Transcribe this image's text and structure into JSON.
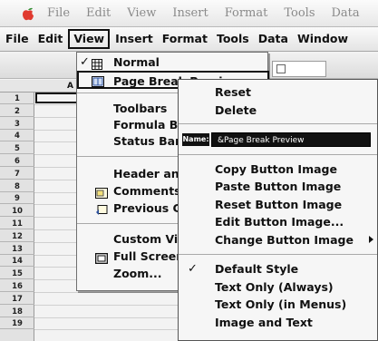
{
  "app_menubar": {
    "items": [
      "File",
      "Edit",
      "View",
      "Insert",
      "Format",
      "Tools",
      "Data"
    ]
  },
  "customize_menubar": {
    "items": [
      "File",
      "Edit",
      "View",
      "Insert",
      "Format",
      "Tools",
      "Data",
      "Window"
    ],
    "active": "View"
  },
  "sheet": {
    "column_header": "A",
    "rows": [
      "1",
      "2",
      "3",
      "4",
      "5",
      "6",
      "7",
      "8",
      "9",
      "10",
      "11",
      "12",
      "13",
      "14",
      "15",
      "16",
      "17",
      "18",
      "19"
    ]
  },
  "view_menu": {
    "items": [
      {
        "label": "Normal",
        "icon": "normal-view-icon",
        "checked": true
      },
      {
        "label": "Page Break Preview",
        "icon": "page-break-icon",
        "highlighted": true
      },
      {
        "label": "Toolbars"
      },
      {
        "label": "Formula Bar"
      },
      {
        "label": "Status Bar"
      },
      {
        "label": "Header and Footer"
      },
      {
        "label": "Comments",
        "icon": "comments-icon"
      },
      {
        "label": "Previous Comments",
        "icon": "previous-comments-icon"
      },
      {
        "label": "Custom Views"
      },
      {
        "label": "Full Screen",
        "icon": "full-screen-icon"
      },
      {
        "label": "Zoom..."
      }
    ]
  },
  "context_menu": {
    "top_items": [
      "Reset",
      "Delete"
    ],
    "name_label": "Name:",
    "name_value": "&Page Break Preview",
    "image_items": [
      "Copy Button Image",
      "Paste Button Image",
      "Reset Button Image",
      "Edit Button Image...",
      "Change Button Image"
    ],
    "style_items": [
      {
        "label": "Default Style",
        "checked": true
      },
      {
        "label": "Text Only (Always)"
      },
      {
        "label": "Text Only (in Menus)"
      },
      {
        "label": "Image and Text"
      }
    ]
  }
}
